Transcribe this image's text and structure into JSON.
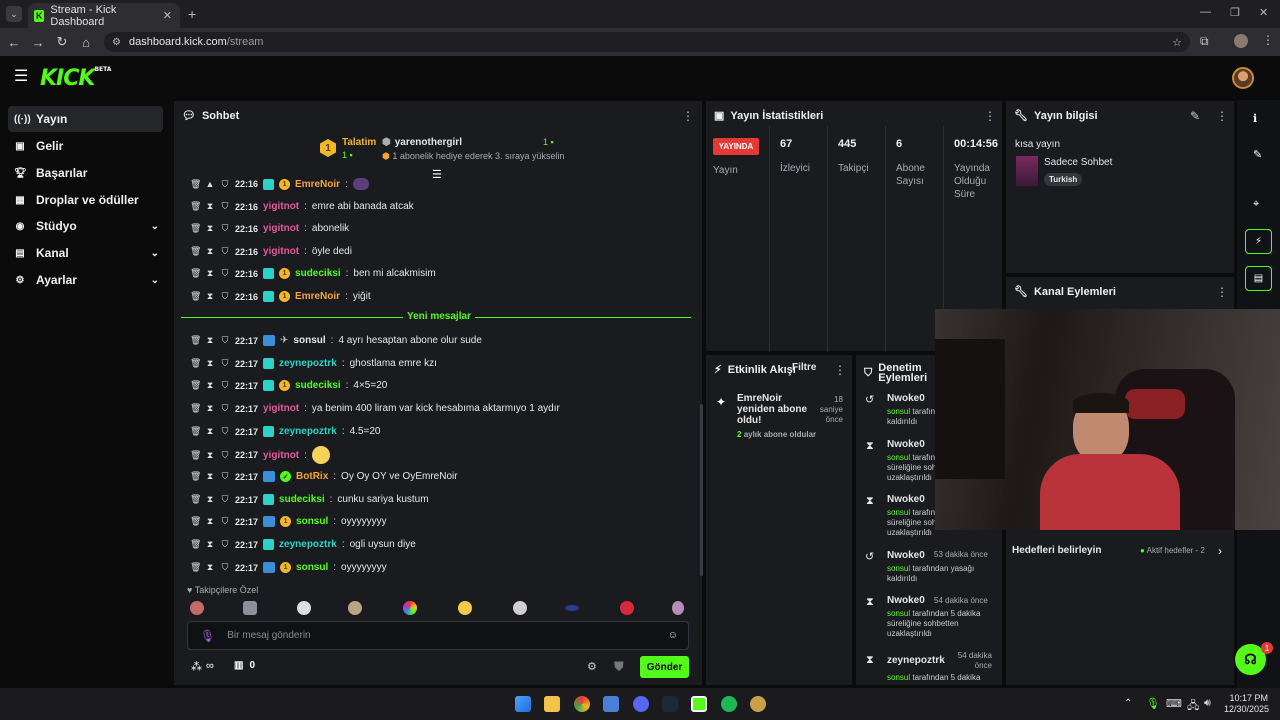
{
  "browser": {
    "tab_title": "Stream - Kick Dashboard",
    "url_host": "dashboard.kick.com",
    "url_path": "/stream"
  },
  "brand": {
    "logo": "KICK",
    "beta": "BETA",
    "accent": "#53fc18"
  },
  "sidebar": {
    "items": [
      {
        "label": "Yayın",
        "icon": "broadcast-icon",
        "active": true
      },
      {
        "label": "Gelir",
        "icon": "revenue-icon"
      },
      {
        "label": "Başarılar",
        "icon": "trophy-icon"
      },
      {
        "label": "Droplar ve ödüller",
        "icon": "gift-icon"
      },
      {
        "label": "Stüdyo",
        "icon": "studio-icon",
        "expand": true
      },
      {
        "label": "Kanal",
        "icon": "channel-icon",
        "expand": true
      },
      {
        "label": "Ayarlar",
        "icon": "settings-icon",
        "expand": true
      }
    ]
  },
  "chat": {
    "title": "Sohbet",
    "leaderboard": {
      "left_label": "Talatim",
      "left_count": "1",
      "user": "yarenothergirl",
      "right_count": "1",
      "note": "1 abonelik hediye ederek 3. sıraya yükselin"
    },
    "messages": [
      {
        "time": "22:16",
        "user": "EmreNoir",
        "text": "",
        "color": "#f3a534"
      },
      {
        "time": "22:16",
        "user": "yigitnot",
        "text": "emre abi banada atcak",
        "color": "#e25b9b"
      },
      {
        "time": "22:16",
        "user": "yigitnot",
        "text": "abonelik",
        "color": "#e25b9b"
      },
      {
        "time": "22:16",
        "user": "yigitnot",
        "text": "öyle dedi",
        "color": "#e25b9b"
      },
      {
        "time": "22:16",
        "user": "sudeciksi",
        "text": "ben mi alcakmisim",
        "color": "#53fc18"
      },
      {
        "time": "22:16",
        "user": "EmreNoir",
        "text": "yiğit",
        "color": "#f3a534"
      }
    ],
    "new_messages_label": "Yeni mesajlar",
    "messages_new": [
      {
        "time": "22:17",
        "user": "sonsul",
        "text": "4 ayrı hesaptan abone olur sude",
        "color": "#e6e6e6"
      },
      {
        "time": "22:17",
        "user": "zeynepoztrk",
        "text": "ghostlama emre kzı",
        "color": "#2bd4c6"
      },
      {
        "time": "22:17",
        "user": "sudeciksi",
        "text": "4×5=20",
        "color": "#53fc18"
      },
      {
        "time": "22:17",
        "user": "yigitnot",
        "text": "ya benim 400 liram var kick hesabıma aktarmıyo 1 aydır",
        "color": "#e25b9b"
      },
      {
        "time": "22:17",
        "user": "zeynepoztrk",
        "text": "4.5=20",
        "color": "#2bd4c6"
      },
      {
        "time": "22:17",
        "user": "yigitnot",
        "text": "",
        "color": "#e25b9b"
      },
      {
        "time": "22:17",
        "user": "BotRix",
        "text": "Oy Oy OY ve OyEmreNoir",
        "color": "#f3a534"
      },
      {
        "time": "22:17",
        "user": "sudeciksi",
        "text": "cunku sariya kustum",
        "color": "#53fc18"
      },
      {
        "time": "22:17",
        "user": "sonsul",
        "text": "oyyyyyyyy",
        "color": "#53fc18"
      },
      {
        "time": "22:17",
        "user": "zeynepoztrk",
        "text": "ogli uysun diye",
        "color": "#2bd4c6"
      },
      {
        "time": "22:17",
        "user": "sonsul",
        "text": "oyyyyyyyy",
        "color": "#53fc18"
      }
    ],
    "followers_only": "Takipçilere Özel",
    "input_placeholder": "Bir mesaj gönderin",
    "send_label": "Gönder",
    "points": "∞",
    "store_count": "0"
  },
  "stats": {
    "title": "Yayın İstatistikleri",
    "live_badge": "YAYINDA",
    "live_label": "Yayın",
    "columns": [
      {
        "value": "67",
        "label": "İzleyici"
      },
      {
        "value": "445",
        "label": "Takipçi"
      },
      {
        "value": "6",
        "label": "Abone Sayısı"
      },
      {
        "value": "00:14:56",
        "label": "Yayında Olduğu Süre"
      }
    ]
  },
  "info": {
    "title": "Yayın bilgisi",
    "stream_title": "kısa yayın",
    "category": "Sadece Sohbet",
    "language": "Turkish"
  },
  "channel_actions": {
    "title": "Kanal Eylemleri"
  },
  "goals": {
    "title": "Hedefleri belirleyin",
    "active": "Aktif hedefler - 2"
  },
  "activity": {
    "title": "Etkinlik Akışı",
    "filter": "Filtre",
    "event": {
      "title": "EmreNoir yeniden abone oldu!",
      "time": "18 saniye önce",
      "detail_count": "2",
      "detail": "aylık abone oldular"
    }
  },
  "moderation": {
    "title": "Denetim Eylemleri",
    "items": [
      {
        "user": "Nwoke0",
        "time": "",
        "line1_user": "sonsul",
        "line1": "tarafından",
        "line2": "kaldırıldı",
        "icon": "undo-icon"
      },
      {
        "user": "Nwoke0",
        "time": "",
        "line1_user": "sonsul",
        "line1": "tarafından",
        "line2": "süreliğine sohbetten",
        "line3": "uzaklaştırıldı",
        "icon": "hourglass-icon"
      },
      {
        "user": "Nwoke0",
        "time": "",
        "line1_user": "sonsul",
        "line1": "tarafından",
        "line2": "süreliğine sohbetten",
        "line3": "uzaklaştırıldı",
        "icon": "hourglass-icon"
      },
      {
        "user": "Nwoke0",
        "time": "53 dakika önce",
        "line1_user": "sonsul",
        "line1": "tarafından yasağı",
        "line2": "kaldırıldı",
        "icon": "undo-icon"
      },
      {
        "user": "Nwoke0",
        "time": "54 dakika önce",
        "line1_user": "sonsul",
        "line1": "tarafından 5 dakika",
        "line2": "süreliğine sohbetten",
        "line3": "uzaklaştırıldı",
        "icon": "hourglass-icon"
      },
      {
        "user": "zeynepoztrk",
        "time": "54 dakika önce",
        "line1_user": "sonsul",
        "line1": "tarafından 5 dakika",
        "line2": "",
        "icon": "hourglass-icon"
      }
    ]
  },
  "support_badge": "1",
  "taskbar": {
    "time": "10:17 PM",
    "date": "12/30/2025"
  }
}
